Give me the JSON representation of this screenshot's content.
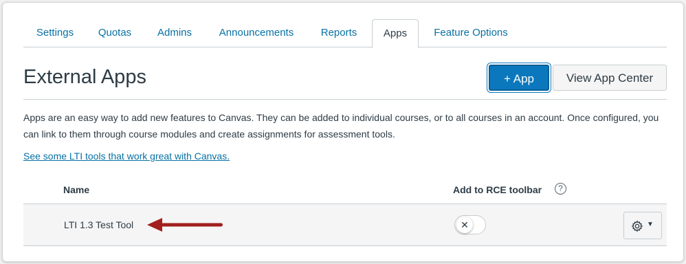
{
  "tabs": [
    {
      "label": "Settings"
    },
    {
      "label": "Quotas"
    },
    {
      "label": "Admins"
    },
    {
      "label": "Announcements"
    },
    {
      "label": "Reports"
    },
    {
      "label": "Apps"
    },
    {
      "label": "Feature Options"
    }
  ],
  "active_tab": "Apps",
  "header": {
    "title": "External Apps",
    "add_app_label": "+ App",
    "view_center_label": "View App Center"
  },
  "description": "Apps are an easy way to add new features to Canvas. They can be added to individual courses, or to all courses in an account. Once configured, you can link to them through course modules and create assignments for assessment tools.",
  "lti_link": "See some LTI tools that work great with Canvas.",
  "table": {
    "col_name": "Name",
    "col_rce": "Add to RCE toolbar",
    "help_glyph": "?",
    "rows": [
      {
        "name": "LTI 1.3 Test Tool",
        "toggle_glyph": "✕",
        "rce_enabled": false
      }
    ]
  },
  "colors": {
    "link": "#0770a3",
    "primary": "#0b78bd",
    "arrow": "#a31f1f",
    "text": "#2d3b45"
  },
  "icons": {
    "help": "question-circle-icon",
    "toggle_off": "x-icon",
    "settings": "gear-icon",
    "menu": "caret-down-icon",
    "annotation": "arrow-left-icon"
  }
}
